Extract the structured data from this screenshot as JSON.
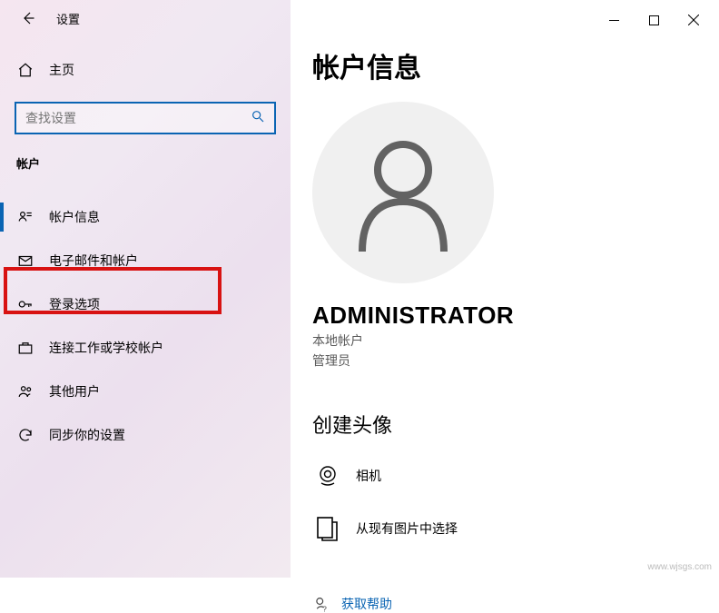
{
  "title_bar": {
    "app_title": "设置"
  },
  "sidebar": {
    "home_label": "主页",
    "search_placeholder": "查找设置",
    "section_label": "帐户",
    "items": [
      {
        "label": "帐户信息"
      },
      {
        "label": "电子邮件和帐户"
      },
      {
        "label": "登录选项"
      },
      {
        "label": "连接工作或学校帐户"
      },
      {
        "label": "其他用户"
      },
      {
        "label": "同步你的设置"
      }
    ]
  },
  "main": {
    "page_title": "帐户信息",
    "username": "ADMINISTRATOR",
    "account_type": "本地帐户",
    "account_role": "管理员",
    "create_avatar_title": "创建头像",
    "option_camera": "相机",
    "option_browse": "从现有图片中选择",
    "help_link": "获取帮助"
  },
  "watermark": "www.wjsgs.com"
}
